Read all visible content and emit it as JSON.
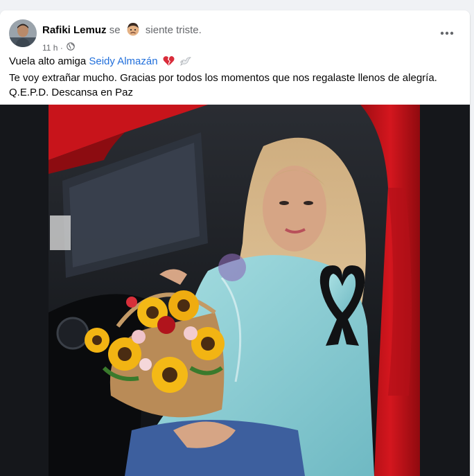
{
  "post": {
    "author": "Rafiki Lemuz",
    "feeling_prefix": "se",
    "feeling_text": "siente triste.",
    "timestamp": "11 h",
    "meta_separator": "·",
    "audience_icon": "globe-icon",
    "more_icon": "more-horizontal-icon",
    "text_line1_prefix": "Vuela alto amiga ",
    "mention": "Seidy Almazán",
    "text_line2": "Te voy extrañar mucho. Gracias por todos los momentos que nos regalaste llenos de alegría.",
    "text_line3": "Q.E.P.D. Descansa en Paz"
  },
  "colors": {
    "mention": "#216fdb",
    "name": "#050505",
    "secondary_text": "#65676b",
    "card": "#ffffff",
    "page_bg": "#f0f2f5",
    "car_red": "#c8141b"
  }
}
